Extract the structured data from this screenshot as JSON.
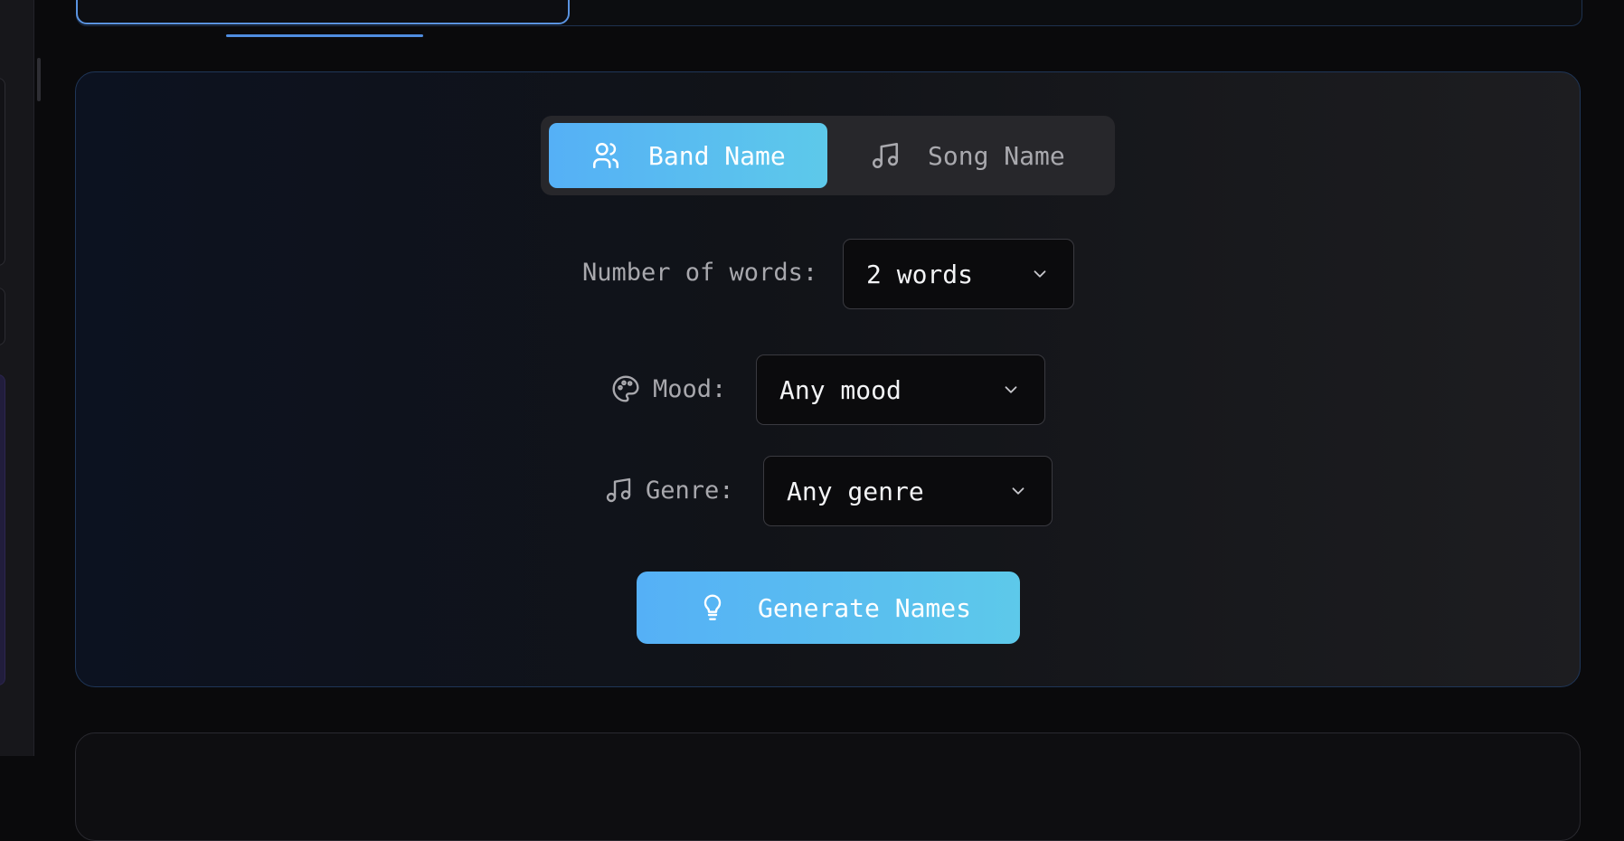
{
  "mode_toggle": {
    "band_label": "Band Name",
    "song_label": "Song Name",
    "selected": "Band Name"
  },
  "words": {
    "label": "Number of words:",
    "value": "2 words"
  },
  "mood": {
    "label": "Mood:",
    "value": "Any mood"
  },
  "genre": {
    "label": "Genre:",
    "value": "Any genre"
  },
  "generate_button": {
    "label": "Generate Names"
  },
  "icons": {
    "band": "users-icon",
    "song": "music-note-icon",
    "mood": "palette-icon",
    "genre": "music-note-icon",
    "generate": "lightbulb-icon",
    "dropdown": "chevron-down-icon"
  },
  "colors": {
    "accent_start": "#55b0f6",
    "accent_end": "#5dc9ea",
    "tab_active_border": "#5a93e0"
  }
}
